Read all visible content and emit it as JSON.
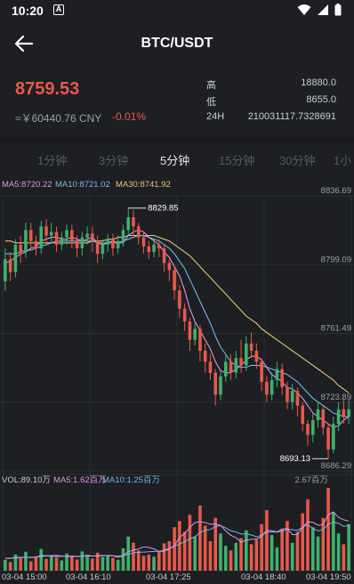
{
  "status": {
    "time": "10:20",
    "app_icon_letter": "A"
  },
  "header": {
    "title": "BTC/USDT"
  },
  "ticker": {
    "price": "8759.53",
    "cny": "≈￥60440.76 CNY",
    "change": "-0.01%",
    "high_label": "高",
    "high": "18880.0",
    "low_label": "低",
    "low": "8655.0",
    "vol_label": "24H",
    "vol": "210031117.7328691"
  },
  "tabs": [
    {
      "label": "1分钟",
      "active": false
    },
    {
      "label": "3分钟",
      "active": false
    },
    {
      "label": "5分钟",
      "active": true
    },
    {
      "label": "15分钟",
      "active": false
    },
    {
      "label": "30分钟",
      "active": false
    },
    {
      "label": "1小",
      "active": false
    }
  ],
  "colors": {
    "up": "#3db26e",
    "down": "#e8594a",
    "ma5": "#d697e6",
    "ma10": "#6fb7e8",
    "ma30": "#e6c27a"
  },
  "chart_data": {
    "type": "candlestick",
    "legend": {
      "ma5": "MA5:8720.22",
      "ma10": "MA10:8721.02",
      "ma30": "MA30:8741.92"
    },
    "ylim": [
      8686.29,
      8836.69
    ],
    "y_ticks": [
      "8836.69",
      "8799.09",
      "8761.49",
      "8723.89",
      "8686.29"
    ],
    "x_ticks": [
      "03-04 15:00",
      "03-04 16:10",
      "03-04 17:25",
      "03-04 18:40",
      "03-04 19:50"
    ],
    "max_label": "8829.85",
    "min_label": "8693.13",
    "volume": {
      "legend_vol": "VOL:89.10万",
      "legend_ma5": "MA5:1.62百万",
      "legend_ma10": "MA10:1.25百万",
      "max_label": "2.67百万",
      "max": 2.67
    },
    "candles": [
      [
        8790,
        8802,
        8785,
        8808
      ],
      [
        8802,
        8795,
        8790,
        8806
      ],
      [
        8795,
        8810,
        8792,
        8813
      ],
      [
        8810,
        8806,
        8800,
        8815
      ],
      [
        8806,
        8818,
        8803,
        8822
      ],
      [
        8818,
        8812,
        8808,
        8822
      ],
      [
        8812,
        8808,
        8804,
        8815
      ],
      [
        8808,
        8820,
        8805,
        8823
      ],
      [
        8820,
        8815,
        8810,
        8824
      ],
      [
        8815,
        8817,
        8811,
        8822
      ],
      [
        8817,
        8810,
        8806,
        8820
      ],
      [
        8810,
        8814,
        8807,
        8817
      ],
      [
        8814,
        8818,
        8810,
        8821
      ],
      [
        8818,
        8812,
        8808,
        8821
      ],
      [
        8812,
        8808,
        8803,
        8815
      ],
      [
        8808,
        8814,
        8804,
        8817
      ],
      [
        8814,
        8816,
        8810,
        8820
      ],
      [
        8816,
        8812,
        8806,
        8820
      ],
      [
        8812,
        8805,
        8800,
        8815
      ],
      [
        8805,
        8810,
        8802,
        8813
      ],
      [
        8810,
        8813,
        8806,
        8816
      ],
      [
        8813,
        8808,
        8804,
        8816
      ],
      [
        8808,
        8812,
        8805,
        8815
      ],
      [
        8812,
        8818,
        8809,
        8821
      ],
      [
        8818,
        8825,
        8815,
        8830
      ],
      [
        8825,
        8820,
        8815,
        8829
      ],
      [
        8820,
        8814,
        8810,
        8822
      ],
      [
        8814,
        8809,
        8805,
        8817
      ],
      [
        8809,
        8806,
        8802,
        8812
      ],
      [
        8806,
        8810,
        8803,
        8813
      ],
      [
        8810,
        8808,
        8803,
        8813
      ],
      [
        8808,
        8800,
        8795,
        8810
      ],
      [
        8800,
        8796,
        8790,
        8802
      ],
      [
        8796,
        8785,
        8780,
        8798
      ],
      [
        8785,
        8775,
        8770,
        8788
      ],
      [
        8775,
        8768,
        8763,
        8778
      ],
      [
        8768,
        8758,
        8752,
        8770
      ],
      [
        8758,
        8764,
        8755,
        8768
      ],
      [
        8764,
        8752,
        8746,
        8766
      ],
      [
        8752,
        8746,
        8740,
        8756
      ],
      [
        8746,
        8740,
        8736,
        8750
      ],
      [
        8740,
        8728,
        8722,
        8742
      ],
      [
        8728,
        8738,
        8725,
        8742
      ],
      [
        8738,
        8746,
        8735,
        8750
      ],
      [
        8746,
        8740,
        8736,
        8750
      ],
      [
        8740,
        8748,
        8737,
        8752
      ],
      [
        8748,
        8744,
        8740,
        8758
      ],
      [
        8744,
        8756,
        8741,
        8760
      ],
      [
        8756,
        8752,
        8748,
        8762
      ],
      [
        8752,
        8746,
        8742,
        8756
      ],
      [
        8746,
        8735,
        8730,
        8748
      ],
      [
        8735,
        8728,
        8724,
        8738
      ],
      [
        8728,
        8736,
        8725,
        8740
      ],
      [
        8736,
        8742,
        8732,
        8746
      ],
      [
        8742,
        8732,
        8728,
        8745
      ],
      [
        8732,
        8724,
        8720,
        8735
      ],
      [
        8724,
        8730,
        8720,
        8734
      ],
      [
        8730,
        8722,
        8716,
        8732
      ],
      [
        8722,
        8712,
        8708,
        8724
      ],
      [
        8712,
        8706,
        8700,
        8714
      ],
      [
        8706,
        8714,
        8702,
        8718
      ],
      [
        8714,
        8720,
        8710,
        8724
      ],
      [
        8720,
        8710,
        8706,
        8722
      ],
      [
        8710,
        8698,
        8693,
        8712
      ],
      [
        8698,
        8712,
        8696,
        8716
      ],
      [
        8712,
        8720,
        8708,
        8724
      ],
      [
        8720,
        8716,
        8712,
        8726
      ],
      [
        8716,
        8720,
        8712,
        8725
      ]
    ],
    "volumes": [
      0.35,
      0.28,
      0.52,
      0.4,
      0.61,
      0.3,
      0.45,
      0.7,
      0.38,
      0.5,
      0.42,
      0.33,
      0.55,
      0.47,
      0.36,
      0.62,
      0.48,
      0.39,
      0.58,
      0.44,
      0.5,
      0.41,
      0.35,
      0.72,
      1.1,
      0.9,
      0.65,
      0.48,
      0.52,
      0.45,
      0.6,
      0.88,
      0.95,
      1.4,
      1.6,
      1.25,
      1.8,
      1.1,
      2.1,
      1.45,
      0.95,
      1.7,
      1.2,
      0.8,
      0.65,
      0.9,
      1.05,
      1.3,
      0.85,
      1.0,
      1.5,
      1.95,
      1.15,
      0.75,
      1.35,
      1.6,
      0.9,
      1.25,
      1.85,
      2.3,
      1.4,
      1.1,
      1.7,
      2.67,
      1.9,
      1.2,
      0.85,
      1.5
    ],
    "ma5": [
      8800,
      8801,
      8803,
      8805,
      8806,
      8808,
      8809,
      8812,
      8813,
      8814,
      8814,
      8813,
      8813,
      8814,
      8813,
      8812,
      8813,
      8814,
      8811,
      8810,
      8811,
      8812,
      8811,
      8811,
      8815,
      8817,
      8818,
      8817,
      8814,
      8812,
      8810,
      8806,
      8803,
      8798,
      8793,
      8785,
      8775,
      8768,
      8763,
      8758,
      8753,
      8746,
      8741,
      8740,
      8740,
      8742,
      8744,
      8747,
      8749,
      8749,
      8747,
      8743,
      8739,
      8737,
      8735,
      8732,
      8731,
      8729,
      8726,
      8722,
      8718,
      8716,
      8714,
      8712,
      8710,
      8711,
      8714,
      8716
    ],
    "ma10": [
      8805,
      8805,
      8805,
      8806,
      8807,
      8807,
      8808,
      8809,
      8810,
      8811,
      8812,
      8812,
      8812,
      8812,
      8812,
      8812,
      8812,
      8812,
      8811,
      8811,
      8811,
      8811,
      8811,
      8812,
      8813,
      8814,
      8815,
      8815,
      8814,
      8813,
      8812,
      8810,
      8808,
      8805,
      8801,
      8797,
      8791,
      8785,
      8779,
      8773,
      8767,
      8760,
      8754,
      8750,
      8746,
      8744,
      8743,
      8743,
      8744,
      8744,
      8744,
      8743,
      8742,
      8741,
      8740,
      8739,
      8737,
      8735,
      8732,
      8729,
      8726,
      8724,
      8722,
      8720,
      8718,
      8717,
      8716,
      8716
    ],
    "ma30": [
      8812,
      8812,
      8811,
      8811,
      8811,
      8811,
      8811,
      8811,
      8811,
      8811,
      8811,
      8811,
      8811,
      8811,
      8811,
      8811,
      8811,
      8812,
      8812,
      8812,
      8813,
      8813,
      8814,
      8814,
      8815,
      8815,
      8815,
      8815,
      8815,
      8815,
      8814,
      8813,
      8812,
      8810,
      8808,
      8806,
      8804,
      8801,
      8798,
      8795,
      8792,
      8789,
      8786,
      8783,
      8780,
      8777,
      8774,
      8771,
      8769,
      8767,
      8764,
      8762,
      8760,
      8758,
      8756,
      8754,
      8752,
      8750,
      8748,
      8746,
      8744,
      8742,
      8740,
      8738,
      8736,
      8733,
      8731,
      8729
    ],
    "vol_ma5": [
      0.4,
      0.4,
      0.42,
      0.43,
      0.43,
      0.42,
      0.44,
      0.49,
      0.48,
      0.48,
      0.49,
      0.47,
      0.45,
      0.46,
      0.45,
      0.46,
      0.5,
      0.47,
      0.48,
      0.49,
      0.48,
      0.48,
      0.43,
      0.48,
      0.62,
      0.66,
      0.7,
      0.77,
      0.75,
      0.7,
      0.62,
      0.63,
      0.7,
      0.81,
      1.07,
      1.2,
      1.39,
      1.55,
      1.58,
      1.55,
      1.5,
      1.5,
      1.46,
      1.28,
      1.14,
      1.06,
      0.92,
      0.98,
      1.01,
      1.02,
      1.1,
      1.3,
      1.29,
      1.25,
      1.34,
      1.36,
      1.16,
      1.17,
      1.39,
      1.58,
      1.56,
      1.46,
      1.49,
      1.81,
      1.89,
      1.72,
      1.64,
      1.6
    ],
    "vol_ma10": [
      0.4,
      0.4,
      0.41,
      0.42,
      0.43,
      0.43,
      0.44,
      0.46,
      0.47,
      0.47,
      0.46,
      0.46,
      0.47,
      0.47,
      0.46,
      0.47,
      0.47,
      0.47,
      0.47,
      0.48,
      0.49,
      0.48,
      0.47,
      0.48,
      0.53,
      0.57,
      0.59,
      0.6,
      0.61,
      0.62,
      0.62,
      0.66,
      0.72,
      0.78,
      0.86,
      0.93,
      1.03,
      1.09,
      1.23,
      1.3,
      1.33,
      1.42,
      1.45,
      1.38,
      1.29,
      1.25,
      1.18,
      1.19,
      1.15,
      1.09,
      1.14,
      1.24,
      1.25,
      1.24,
      1.27,
      1.34,
      1.32,
      1.3,
      1.4,
      1.48,
      1.36,
      1.28,
      1.33,
      1.5,
      1.56,
      1.53,
      1.43,
      1.45
    ]
  }
}
